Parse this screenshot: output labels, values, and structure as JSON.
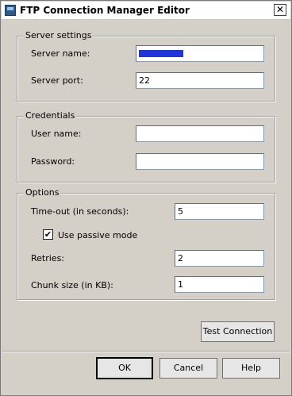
{
  "window": {
    "title": "FTP Connection Manager Editor",
    "close_glyph": "✕"
  },
  "server_settings": {
    "legend": "Server settings",
    "server_name_label": "Server name:",
    "server_name_value": "",
    "server_port_label": "Server port:",
    "server_port_value": "22"
  },
  "credentials": {
    "legend": "Credentials",
    "user_name_label": "User name:",
    "user_name_value": "",
    "password_label": "Password:",
    "password_value": ""
  },
  "options": {
    "legend": "Options",
    "timeout_label": "Time-out (in seconds):",
    "timeout_value": "5",
    "passive_label": "Use passive mode",
    "passive_checked": true,
    "check_glyph": "✔",
    "retries_label": "Retries:",
    "retries_value": "2",
    "chunk_label": "Chunk size (in KB):",
    "chunk_value": "1"
  },
  "buttons": {
    "test_connection": "Test Connection",
    "ok": "OK",
    "cancel": "Cancel",
    "help": "Help"
  },
  "icons": {
    "window_icon": "ftp-connection-icon",
    "close": "close-icon",
    "passive_check": "checkmark-icon"
  },
  "colors": {
    "dialog_background": "#d4d0c8",
    "field_background": "#ffffff",
    "redaction": "#2036d8"
  }
}
